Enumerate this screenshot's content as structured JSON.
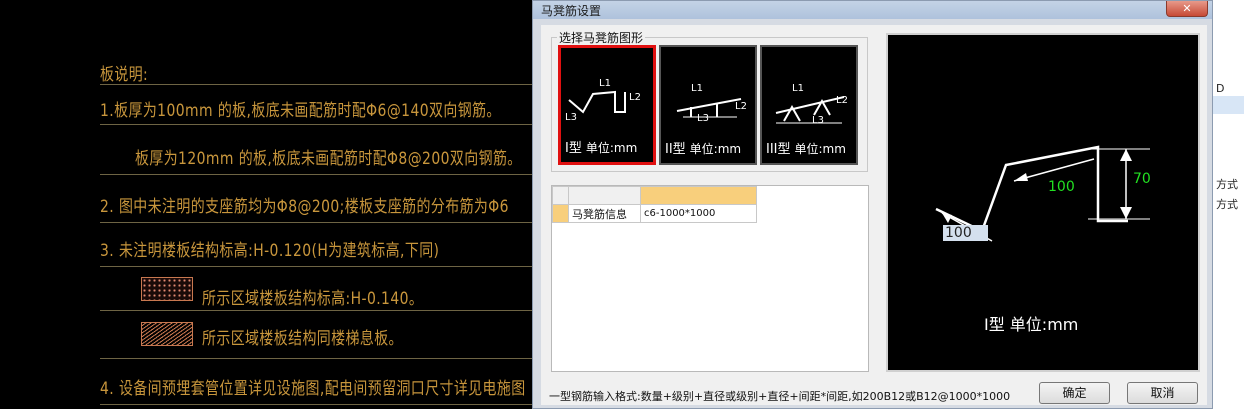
{
  "cad": {
    "title": "板说明:",
    "lines": [
      "1.板厚为100mm 的板,板底未画配筋时配Φ6@140双向钢筋。",
      "板厚为120mm 的板,板底未画配筋时配Φ8@200双向钢筋。",
      "2. 图中未注明的支座筋均为Φ8@200;楼板支座筋的分布筋为Φ6",
      "3. 未注明楼板结构标高:H-0.120(H为建筑标高,下同)",
      "所示区域楼板结构标高:H-0.140。",
      "所示区域楼板结构同楼梯息板。",
      "4. 设备间预埋套管位置详见设施图,配电间预留洞口尺寸详见电施图"
    ]
  },
  "side": {
    "items": [
      "D",
      "方式",
      "方式"
    ]
  },
  "dialog": {
    "title": "马凳筋设置",
    "close": "✕",
    "group_label": "选择马凳筋图形",
    "shapes": [
      {
        "type": "I型",
        "unit": "单位:mm",
        "labels": [
          "L1",
          "L2",
          "L3"
        ]
      },
      {
        "type": "II型",
        "unit": "单位:mm",
        "labels": [
          "L1",
          "L2",
          "L3"
        ]
      },
      {
        "type": "III型",
        "unit": "单位:mm",
        "labels": [
          "L1",
          "L2",
          "L3"
        ]
      }
    ],
    "grid": {
      "row_label": "马凳筋信息",
      "row_value": "c6-1000*1000"
    },
    "preview": {
      "caption": "I型 单位:mm",
      "l1": "100",
      "l2": "70",
      "l3": "100"
    },
    "hint": "一型钢筋输入格式:数量+级别+直径或级别+直径+间距*间距,如200B12或B12@1000*1000",
    "ok": "确定",
    "cancel": "取消"
  }
}
